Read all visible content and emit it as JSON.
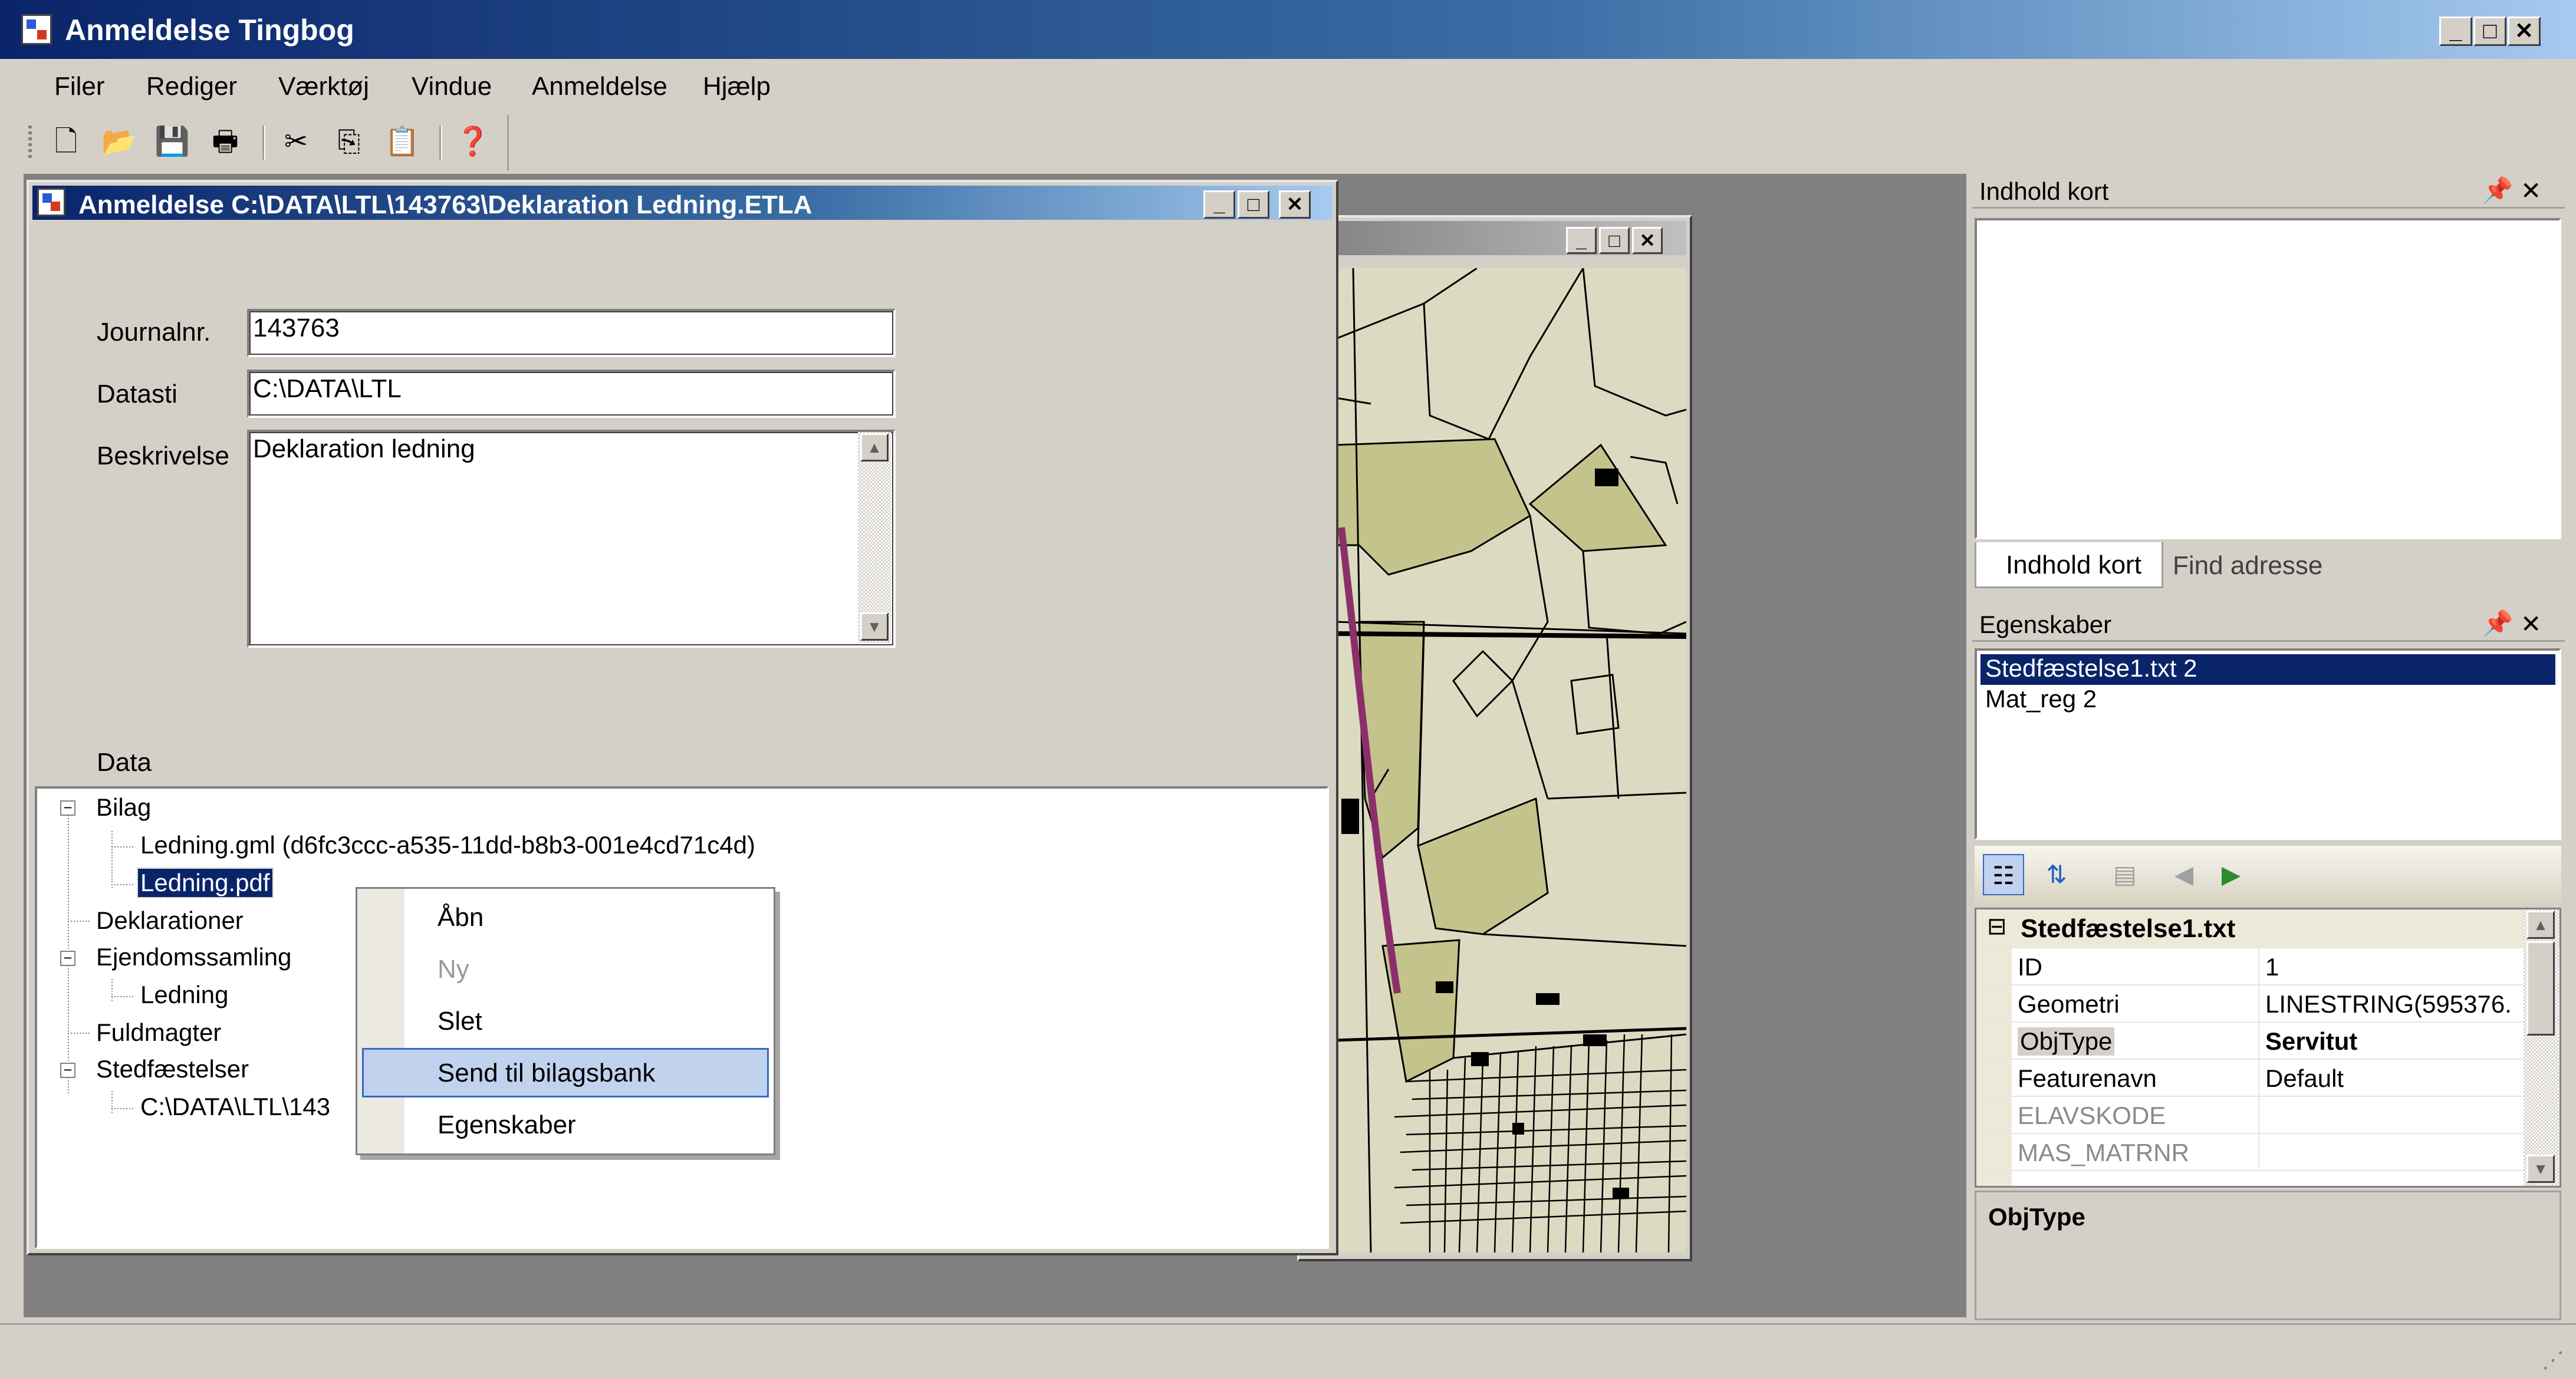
{
  "app": {
    "title": "Anmeldelse Tingbog"
  },
  "menu": {
    "items": [
      "Filer",
      "Rediger",
      "Værktøj",
      "Vindue",
      "Anmeldelse",
      "Hjælp"
    ]
  },
  "toolbar": {
    "buttons": [
      "new-icon",
      "open-icon",
      "save-icon",
      "print-icon",
      "cut-icon",
      "copy-icon",
      "paste-icon",
      "help-icon"
    ]
  },
  "doc_window": {
    "title": "Anmeldelse C:\\DATA\\LTL\\143763\\Deklaration Ledning.ETLA",
    "fields": {
      "journal_label": "Journalnr.",
      "journal_value": "143763",
      "datasti_label": "Datasti",
      "datasti_value": "C:\\DATA\\LTL",
      "beskrivelse_label": "Beskrivelse",
      "beskrivelse_value": "Deklaration ledning"
    },
    "data_label": "Data",
    "tree": {
      "bilag": "Bilag",
      "ledning_gml": "Ledning.gml (d6fc3ccc-a535-11dd-b8b3-001e4cd71c4d)",
      "ledning_pdf": "Ledning.pdf",
      "deklarationer": "Deklarationer",
      "ejendomssamling": "Ejendomssamling",
      "ledning": "Ledning",
      "fuldmagter": "Fuldmagter",
      "stedfaestelser": "Stedfæstelser",
      "stedfaestelse_path": "C:\\DATA\\LTL\\143"
    }
  },
  "context_menu": {
    "items": [
      {
        "label": "Åbn",
        "state": "enabled"
      },
      {
        "label": "Ny",
        "state": "disabled"
      },
      {
        "label": "Slet",
        "state": "enabled"
      },
      {
        "label": "Send til bilagsbank",
        "state": "highlighted"
      },
      {
        "label": "Egenskaber",
        "state": "enabled"
      }
    ]
  },
  "map_panel": {
    "title": "Indhold kort",
    "tabs": [
      "Indhold kort",
      "Find adresse"
    ]
  },
  "properties_panel": {
    "title": "Egenskaber",
    "objects": [
      "Stedfæstelse1.txt 2",
      "Mat_reg 2"
    ],
    "category": "Stedfæstelse1.txt",
    "rows": [
      {
        "key": "ID",
        "value": "1",
        "state": "normal"
      },
      {
        "key": "Geometri",
        "value": "LINESTRING(595376.",
        "state": "normal"
      },
      {
        "key": "ObjType",
        "value": "Servitut",
        "state": "selected"
      },
      {
        "key": "Featurenavn",
        "value": "Default",
        "state": "normal"
      },
      {
        "key": "ELAVSKODE",
        "value": "",
        "state": "readonly"
      },
      {
        "key": "MAS_MATRNR",
        "value": "",
        "state": "readonly"
      }
    ],
    "description_title": "ObjType"
  },
  "colors": {
    "titlebar_start": "#0a246a",
    "titlebar_end": "#a6caf0",
    "selection": "#0a246a",
    "map_green": "#c4c38c",
    "map_route": "#8b2f6b"
  }
}
